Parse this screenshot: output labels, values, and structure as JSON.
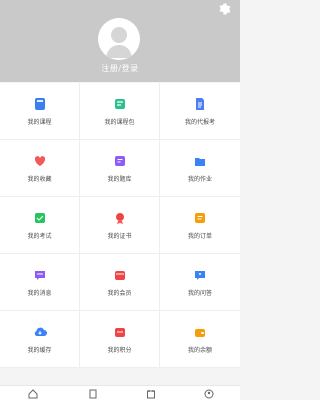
{
  "header": {
    "login_text": "注册/登录",
    "background": "#c9c9c9"
  },
  "menu": [
    {
      "label": "我的课程",
      "icon": "book-icon",
      "color": "#3b7ef0"
    },
    {
      "label": "我的课程包",
      "icon": "package-icon",
      "color": "#2cc08f"
    },
    {
      "label": "我的代报考",
      "icon": "document-icon",
      "color": "#4b80f0"
    },
    {
      "label": "我的收藏",
      "icon": "heart-icon",
      "color": "#f05a5a"
    },
    {
      "label": "我的题库",
      "icon": "question-bank-icon",
      "color": "#8b5cf6"
    },
    {
      "label": "我的作业",
      "icon": "folder-icon",
      "color": "#3b82f6"
    },
    {
      "label": "我的考试",
      "icon": "exam-icon",
      "color": "#22c55e"
    },
    {
      "label": "我的证书",
      "icon": "certificate-icon",
      "color": "#ef4444"
    },
    {
      "label": "我的订单",
      "icon": "order-icon",
      "color": "#f59e0b"
    },
    {
      "label": "我的消息",
      "icon": "message-icon",
      "color": "#8b5cf6"
    },
    {
      "label": "我的会员",
      "icon": "vip-icon",
      "color": "#ef4444"
    },
    {
      "label": "我的问答",
      "icon": "qa-icon",
      "color": "#3b82f6"
    },
    {
      "label": "我的缓存",
      "icon": "cloud-download-icon",
      "color": "#3b82f6"
    },
    {
      "label": "我的积分",
      "icon": "points-icon",
      "color": "#ef4444"
    },
    {
      "label": "我的余额",
      "icon": "wallet-icon",
      "color": "#f59e0b"
    }
  ]
}
